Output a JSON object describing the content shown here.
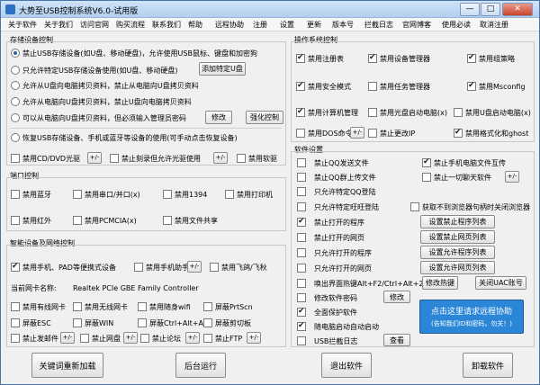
{
  "window": {
    "title": "大势至USB控制系统V6.0-试用版",
    "minimize": "—",
    "maximize": "□",
    "close": "✕"
  },
  "menu": [
    "关于软件",
    "关于我们",
    "访问官网",
    "购买流程",
    "联系我们",
    "帮助",
    "远程协助",
    "注册",
    "设置",
    "更新",
    "版本号",
    "拦截日志",
    "官网博客",
    "使用必读",
    "取消注册"
  ],
  "storage": {
    "title": "存储设备控制",
    "radios": [
      "禁止USB存储设备(如U盘、移动硬盘)，允许使用USB鼠标、键盘和加密狗",
      "只允许特定USB存储设备使用(如U盘、移动硬盘)",
      "允许从U盘向电脑拷贝资料，禁止从电脑向U盘拷贝资料",
      "允许从电脑向U盘拷贝资料，禁止U盘向电脑拷贝资料",
      "可以从电脑向U盘拷贝资料，但必须输入管理员密码"
    ],
    "add_usb": "添加特定U盘",
    "modify": "修改",
    "strong": "强化控制",
    "restore": "恢复USB存储设备、手机或蓝牙等设备的使用(可手动点击恢复设备)",
    "cd_dvd": "禁用CD/DVD光驱",
    "burn": "禁止刻录但允许光驱使用",
    "floppy": "禁用软驱"
  },
  "port": {
    "title": "端口控制",
    "items": [
      "禁用蓝牙",
      "禁用串口/并口(x)",
      "禁用1394",
      "禁用打印机",
      "禁用红外",
      "禁用PCMCIA(x)",
      "禁用文件共享"
    ]
  },
  "smart": {
    "title": "智能设备及网络控制",
    "phone_pad": "禁用手机、PAD等便携式设备",
    "phone_helper": "禁用手机助手",
    "feige": "禁用飞鸽/飞秋",
    "nic_label": "当前网卡名称:",
    "nic_name": "Realtek PCIe GBE Family Controller",
    "items": [
      "禁用有线网卡",
      "禁用无线网卡",
      "禁用随身wifi",
      "屏蔽PrtScn",
      "屏蔽ESC",
      "屏蔽WIN",
      "屏蔽Ctrl+Alt+A",
      "屏蔽剪切板",
      "禁止发邮件",
      "禁止网盘",
      "禁止论坛",
      "禁止FTP"
    ]
  },
  "os": {
    "title": "操作系统控制",
    "items": [
      "禁用注册表",
      "禁用设备管理器",
      "禁用组策略",
      "禁用安全模式",
      "禁用任务管理器",
      "禁用Msconfig",
      "禁用计算机管理",
      "禁用光盘启动电脑(x)",
      "禁用U盘启动电脑(x)",
      "禁用DOS命令",
      "禁止更改IP",
      "禁用格式化和ghost"
    ]
  },
  "soft": {
    "title": "软件设置",
    "qq_send": "禁止QQ发送文件",
    "phone_share": "禁止手机电脑文件互传",
    "qq_group": "禁止QQ群上传文件",
    "one_key": "禁止一切聊天软件",
    "spec_qq": "只允许特定QQ登陆",
    "spec_ww": "只允许特定旺旺登陆",
    "browser": "获取不到浏览器句柄时关闭浏览器",
    "ban_prog": "禁止打开的程序",
    "set_ban_prog": "设置禁止程序列表",
    "ban_web": "禁止打开的网页",
    "set_ban_web": "设置禁止网页列表",
    "allow_prog": "只允许打开的程序",
    "set_allow_prog": "设置允许程序列表",
    "allow_web": "只允许打开的网页",
    "set_allow_web": "设置允许网页列表",
    "hotkey": "唤出界面热键Alt+F2/Ctrl+Alt+2",
    "change_hotkey": "修改热键",
    "uac": "关闭UAC账号",
    "pwd": "修改软件密码",
    "modify": "修改",
    "protect": "全面保护软件",
    "autostart": "随电脑启动自动启动",
    "log": "USB拦截日志",
    "view": "查看",
    "remote_line1": "点击这里请求远程协助",
    "remote_line2": "(告知我们ID和密码，勿关！)"
  },
  "bottom": {
    "reload": "关键词重新加载",
    "background": "后台运行",
    "exit": "退出软件",
    "uninstall": "卸载软件"
  }
}
